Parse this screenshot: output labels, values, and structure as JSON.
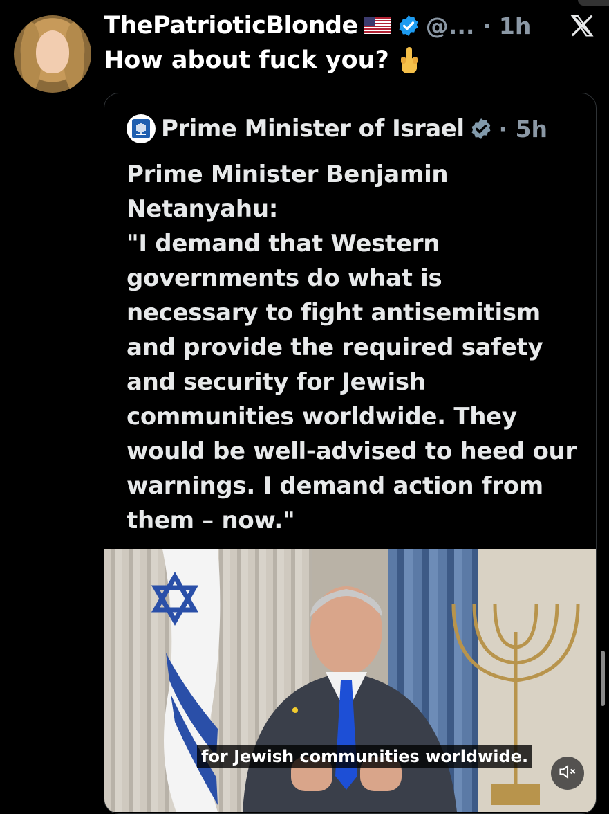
{
  "tweet": {
    "display_name": "ThePatrioticBlonde",
    "flag_icon": "us-flag-icon",
    "handle_time": "@... · 1h",
    "reply_text": "How about fuck you?",
    "reply_emoji": "middle-finger-emoji"
  },
  "quoted": {
    "name": "Prime Minister of Israel",
    "time": "· 5h",
    "body_lines": [
      "Prime Minister Benjamin",
      "Netanyahu:",
      "\"I demand that Western",
      "governments do what is",
      "necessary to fight antisemitism",
      "and provide the required safety",
      "and security for Jewish",
      "communities worldwide. They",
      "would be well-advised to heed our",
      "warnings. I demand action from",
      "them – now.\""
    ],
    "video": {
      "subtitle": "for Jewish communities worldwide."
    }
  },
  "colors": {
    "background": "#000000",
    "text": "#e7e9ea",
    "muted": "#8b98a5",
    "verified_blue": "#1d9bf0",
    "gov_gray": "#829aab"
  }
}
